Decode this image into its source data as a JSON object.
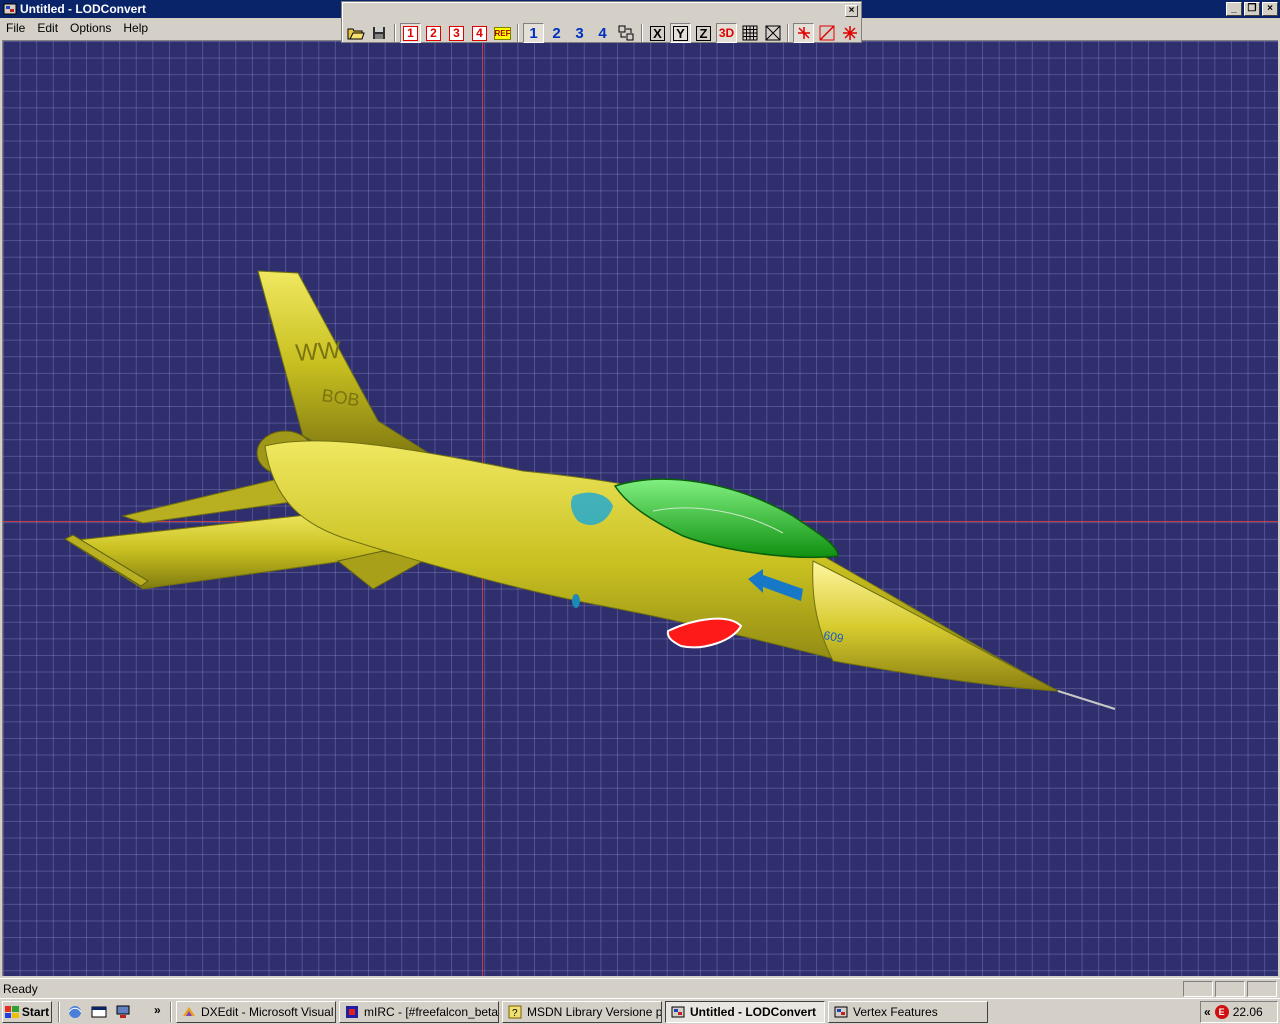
{
  "window": {
    "title": "Untitled - LODConvert",
    "minimize": "_",
    "restore": "❐",
    "close": "×"
  },
  "menu": [
    {
      "label": "File"
    },
    {
      "label": "Edit"
    },
    {
      "label": "Options"
    },
    {
      "label": "Help"
    }
  ],
  "toolbar": {
    "close": "×",
    "open_icon": "open-folder-icon",
    "save_icon": "floppy-disk-icon",
    "lod_red": [
      "1",
      "2",
      "3",
      "4"
    ],
    "ref_label": "REF",
    "lod_blue": [
      "1",
      "2",
      "3",
      "4"
    ],
    "axis": {
      "x": "X",
      "y": "Y",
      "z": "Z"
    },
    "mode_3d": "3D"
  },
  "viewport": {
    "background": "#2f2f6e",
    "grid_color": "#9696d2",
    "axis_color": "#e04040",
    "tail_code": "WW",
    "tail_name": "BOB",
    "nose_number": "609",
    "model_color": "#c8c020",
    "canopy_color": "#30c030"
  },
  "status": {
    "text": "Ready"
  },
  "taskbar": {
    "start": "Start",
    "more": "»",
    "tasks": [
      {
        "label": "DXEdit - Microsoft Visual ...",
        "icon": "visual-studio-icon"
      },
      {
        "label": "mIRC - [#freefalcon_beta ...",
        "icon": "mirc-icon"
      },
      {
        "label": "MSDN Library Versione p...",
        "icon": "msdn-help-icon"
      },
      {
        "label": "Untitled - LODConvert",
        "icon": "lodconvert-icon",
        "active": true
      },
      {
        "label": "Vertex Features",
        "icon": "lodconvert-icon"
      }
    ],
    "tray_arrows": "«",
    "clock": "22.06"
  }
}
